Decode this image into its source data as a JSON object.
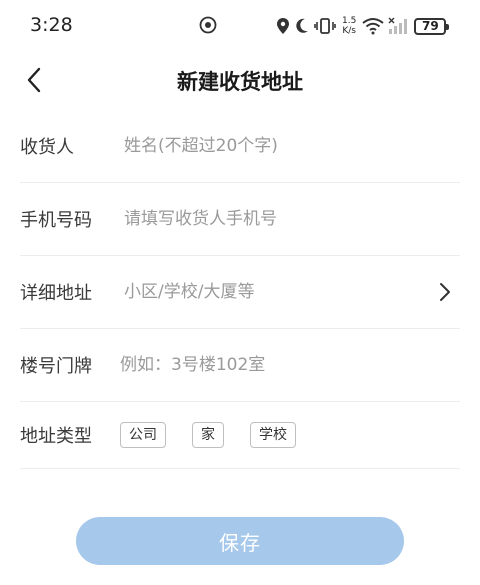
{
  "status_bar": {
    "time": "3:28",
    "net_speed_value": "1.5",
    "net_speed_unit": "K/s",
    "battery": "79",
    "icons": [
      "notification-badge-icon",
      "location-icon",
      "moon-icon",
      "vibrate-icon",
      "wifi-icon",
      "signal-icon",
      "battery-icon"
    ]
  },
  "header": {
    "title": "新建收货地址"
  },
  "form": {
    "recipient": {
      "label": "收货人",
      "placeholder": "姓名(不超过20个字)"
    },
    "phone": {
      "label": "手机号码",
      "placeholder": "请填写收货人手机号"
    },
    "address": {
      "label": "详细地址",
      "placeholder": "小区/学校/大厦等"
    },
    "house_number": {
      "label": "楼号门牌",
      "placeholder": "例如：3号楼102室"
    },
    "address_type": {
      "label": "地址类型",
      "options": [
        "公司",
        "家",
        "学校"
      ]
    }
  },
  "save_button": {
    "label": "保存",
    "color": "#a6c8ea"
  }
}
